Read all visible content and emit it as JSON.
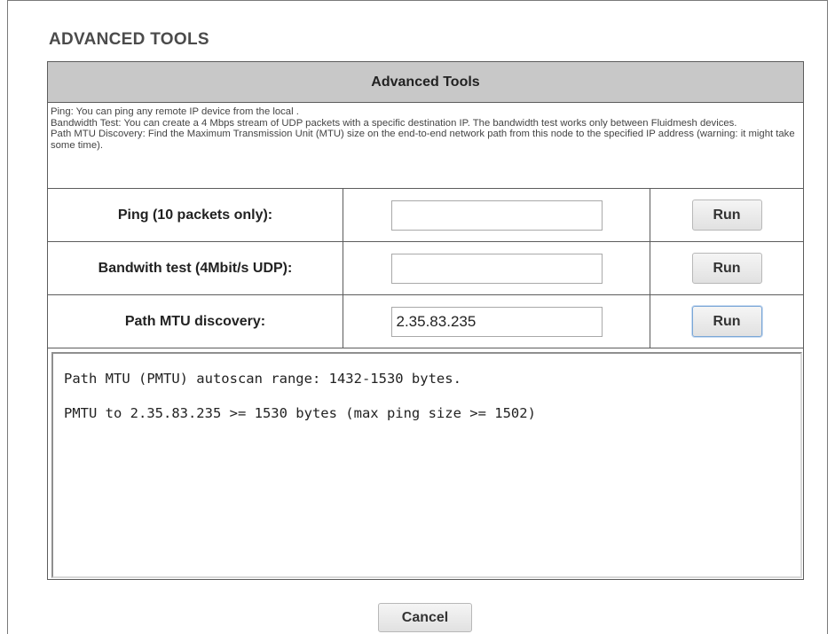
{
  "page": {
    "title": "ADVANCED TOOLS"
  },
  "table": {
    "header": "Advanced Tools",
    "description": [
      "Ping: You can ping any remote IP device from the local .",
      "Bandwidth Test: You can create a 4 Mbps stream of UDP packets with a specific destination IP. The bandwidth test works only between Fluidmesh devices.",
      "Path MTU Discovery: Find the Maximum Transmission Unit (MTU) size on the end-to-end network path from this node to the specified IP address (warning: it might take some time)."
    ],
    "rows": [
      {
        "label": "Ping (10 packets only):",
        "input_value": "",
        "button_label": "Run"
      },
      {
        "label": "Bandwith test (4Mbit/s UDP):",
        "input_value": "",
        "button_label": "Run"
      },
      {
        "label": "Path MTU discovery:",
        "input_value": "2.35.83.235",
        "button_label": "Run"
      }
    ]
  },
  "output": {
    "lines": [
      "Path MTU (PMTU) autoscan range: 1432-1530 bytes.",
      "PMTU to 2.35.83.235 >= 1530 bytes (max ping size >= 1502)"
    ]
  },
  "footer": {
    "cancel_label": "Cancel"
  }
}
